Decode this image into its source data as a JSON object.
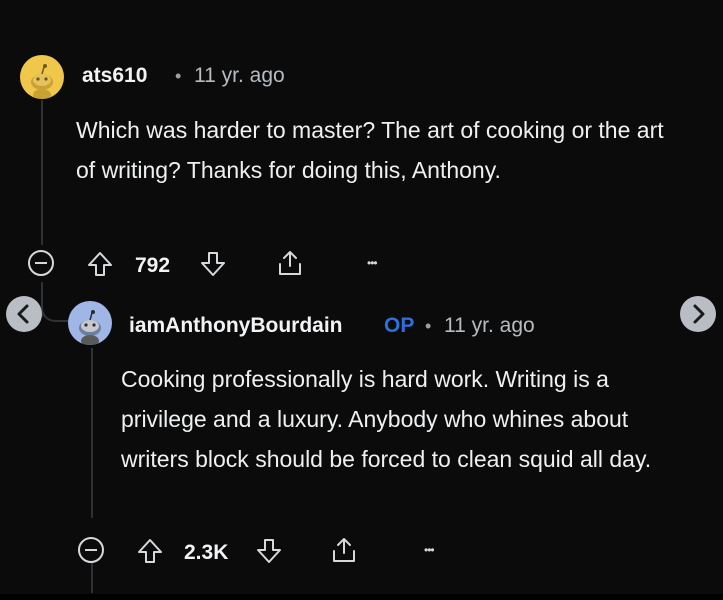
{
  "comments": [
    {
      "username": "ats610",
      "time": "11 yr. ago",
      "body": "Which was harder to master? The art of cooking or the art of writing? Thanks for doing this, Anthony.",
      "votes": "792"
    },
    {
      "username": "iamAnthonyBourdain",
      "op_badge": "OP",
      "time": "11 yr. ago",
      "body": "Cooking professionally is hard work. Writing is a privilege and a luxury. Anybody who whines about writers block should be forced to clean squid all day.",
      "votes": "2.3K"
    }
  ],
  "separator": "•",
  "more_label": "•••",
  "colors": {
    "background": "#0b0b0b",
    "op_badge": "#2f6fd6",
    "avatar1": "#f0c74a",
    "avatar2": "#9fb6e6"
  },
  "icons": [
    "collapse-icon",
    "upvote-icon",
    "downvote-icon",
    "share-icon",
    "more-icon",
    "chevron-left-icon",
    "chevron-right-icon",
    "snoo-avatar-icon"
  ]
}
